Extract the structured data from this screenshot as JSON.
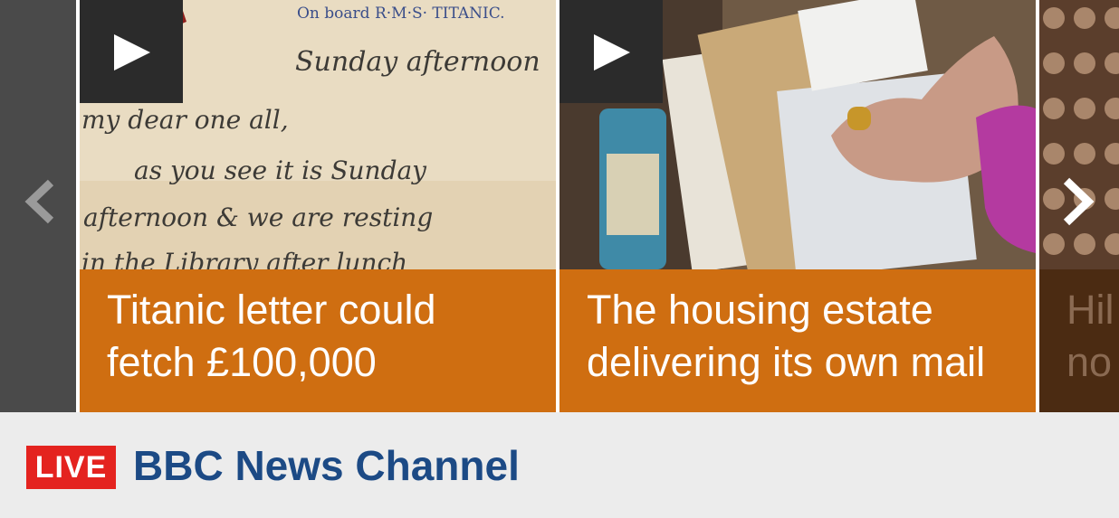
{
  "carousel": {
    "cards": [
      {
        "headline": "Titanic letter could fetch £100,000",
        "line1": "Titanic letter could",
        "line2": "fetch £100,000",
        "has_video": true,
        "letterhead": "On board R·M·S· TITANIC.",
        "handwriting": [
          "Sunday afternoon",
          "my dear one all,",
          "as you see it is Sunday",
          "afternoon & we are resting",
          "in the Library after lunch"
        ]
      },
      {
        "headline": "The housing estate delivering its own mail",
        "line1": "The housing estate",
        "line2": "delivering its own mail",
        "has_video": true
      },
      {
        "line1": "Hil",
        "line2": "no"
      }
    ],
    "prev_icon": "chevron-left-icon",
    "next_icon": "chevron-right-icon",
    "play_icon": "play-icon"
  },
  "live": {
    "badge": "LIVE",
    "channel": "BBC News Channel"
  },
  "colors": {
    "caption_bg": "#cf6e11",
    "live_red": "#e4231f",
    "channel_blue": "#1c4a85",
    "footer_bg": "#ececec"
  }
}
